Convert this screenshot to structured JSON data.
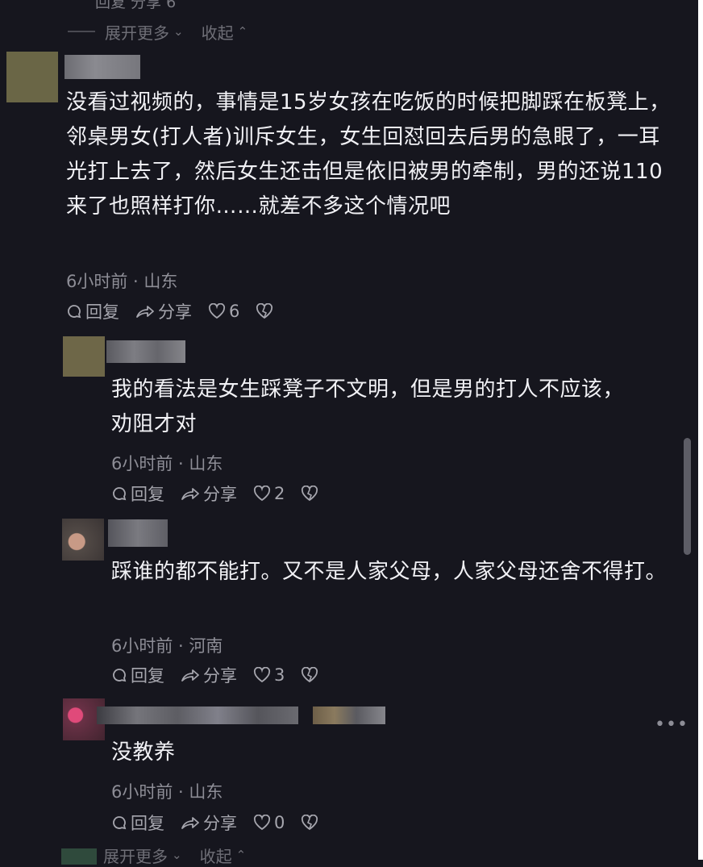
{
  "top_partial": {
    "text": "回复 分享 6"
  },
  "expand_top": {
    "expand_label": "展开更多",
    "collapse_label": "收起"
  },
  "comments": [
    {
      "body": "没看过视频的，事情是15岁女孩在吃饭的时候把脚踩在板凳上，邻桌男女(打人者)训斥女生，女生回怼回去后男的急眼了，一耳光打上去了，然后女生还击但是依旧被男的牵制，男的还说110来了也照样打你……就差不多这个情况吧",
      "time": "6小时前",
      "location": "山东",
      "reply_label": "回复",
      "share_label": "分享",
      "likes": "6"
    },
    {
      "body": "我的看法是女生踩凳子不文明，但是男的打人不应该，劝阻才对",
      "time": "6小时前",
      "location": "山东",
      "reply_label": "回复",
      "share_label": "分享",
      "likes": "2"
    },
    {
      "body": "踩谁的都不能打。又不是人家父母，人家父母还舍不得打。",
      "time": "6小时前",
      "location": "河南",
      "reply_label": "回复",
      "share_label": "分享",
      "likes": "3"
    },
    {
      "body": "没教养",
      "time": "6小时前",
      "location": "山东",
      "reply_label": "回复",
      "share_label": "分享",
      "likes": "0"
    }
  ],
  "expand_bottom": {
    "expand_label": "展开更多",
    "collapse_label": "收起"
  },
  "colors": {
    "background": "#16161e",
    "text": "#f1f1f5",
    "meta": "#8d8d96"
  },
  "icons": [
    "comment-icon",
    "share-icon",
    "like-icon",
    "dislike-icon",
    "chevron-down-icon",
    "chevron-up-icon",
    "more-icon"
  ]
}
